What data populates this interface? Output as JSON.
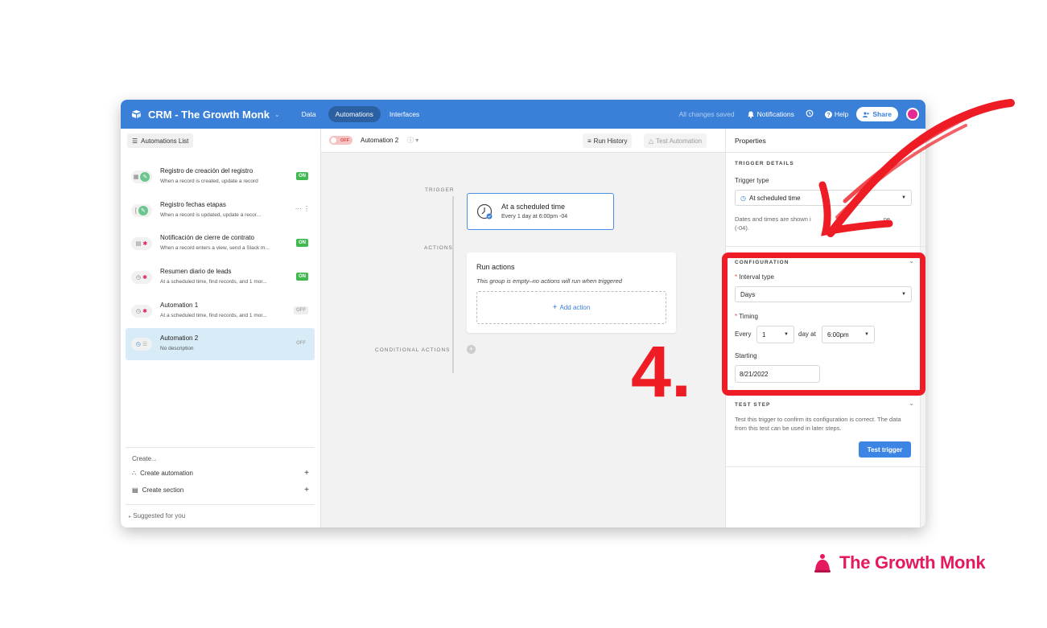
{
  "topbar": {
    "base_title": "CRM - The Growth Monk",
    "nav": [
      "Data",
      "Automations",
      "Interfaces"
    ],
    "saved_status": "All changes saved",
    "notifications": "Notifications",
    "help": "Help",
    "share": "Share"
  },
  "sidebar": {
    "list_button": "Automations List",
    "items": [
      {
        "name": "Registro de creación del registro",
        "desc": "When a record is created, update a record",
        "status": "ON"
      },
      {
        "name": "Registro fechas etapas",
        "desc": "When a record is updated, update a recor...",
        "status": ""
      },
      {
        "name": "Notificación de cierre de contrato",
        "desc": "When a record enters a view, send a Slack m...",
        "status": "ON"
      },
      {
        "name": "Resumen diario de leads",
        "desc": "At a scheduled time, find records, and 1 mor...",
        "status": "ON"
      },
      {
        "name": "Automation 1",
        "desc": "At a scheduled time, find records, and 1 mor...",
        "status": "OFF"
      },
      {
        "name": "Automation 2",
        "desc": "No description",
        "status": "OFF"
      }
    ],
    "create_label": "Create...",
    "create_automation": "Create automation",
    "create_section": "Create section",
    "suggested": "Suggested for you"
  },
  "canvas": {
    "toggle": "OFF",
    "automation_name": "Automation 2",
    "run_history": "Run History",
    "test_automation": "Test Automation",
    "trigger_label": "TRIGGER",
    "actions_label": "ACTIONS",
    "conditional_label": "CONDITIONAL ACTIONS",
    "trigger_title": "At a scheduled time",
    "trigger_sub": "Every 1 day at 6:00pm -04",
    "actions_title": "Run actions",
    "actions_empty": "This group is empty–no actions will run when triggered",
    "add_action": "Add action"
  },
  "properties": {
    "title": "Properties",
    "trigger_details": "TRIGGER DETAILS",
    "trigger_type_label": "Trigger type",
    "trigger_type_value": "At scheduled time",
    "timezone_note_a": "Dates and times are shown i",
    "timezone_note_b": "ne",
    "timezone_note_c": "(-04).",
    "configuration": "CONFIGURATION",
    "interval_type_label": "Interval type",
    "interval_type_value": "Days",
    "timing_label": "Timing",
    "every": "Every",
    "every_value": "1",
    "day_at": "day at",
    "time_value": "6:00pm",
    "starting_label": "Starting",
    "starting_value": "8/21/2022",
    "test_step": "TEST STEP",
    "test_note": "Test this trigger to confirm its configuration is correct. The data from this test can be used in later steps.",
    "test_button": "Test trigger"
  },
  "overlay": {
    "step_number": "4.",
    "brand": "The Growth Monk",
    "accent": "#ee1c24"
  },
  "colors": {
    "topbar": "#3a80d8",
    "brand": "#e6195d"
  }
}
